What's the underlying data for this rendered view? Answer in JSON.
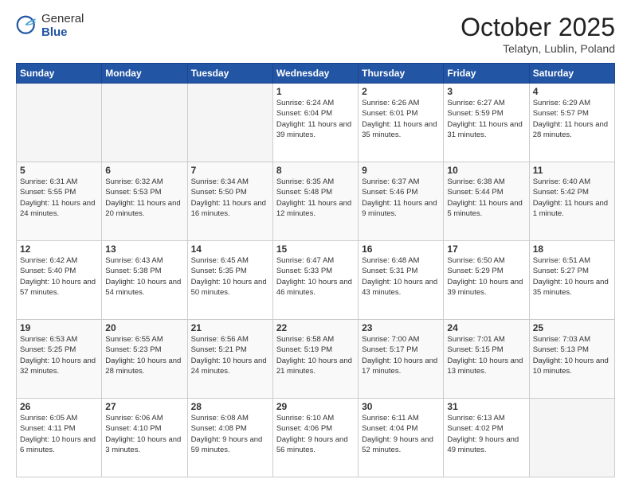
{
  "logo": {
    "general": "General",
    "blue": "Blue"
  },
  "header": {
    "month": "October 2025",
    "location": "Telatyn, Lublin, Poland"
  },
  "weekdays": [
    "Sunday",
    "Monday",
    "Tuesday",
    "Wednesday",
    "Thursday",
    "Friday",
    "Saturday"
  ],
  "weeks": [
    [
      {
        "day": "",
        "sunrise": "",
        "sunset": "",
        "daylight": ""
      },
      {
        "day": "",
        "sunrise": "",
        "sunset": "",
        "daylight": ""
      },
      {
        "day": "",
        "sunrise": "",
        "sunset": "",
        "daylight": ""
      },
      {
        "day": "1",
        "sunrise": "Sunrise: 6:24 AM",
        "sunset": "Sunset: 6:04 PM",
        "daylight": "Daylight: 11 hours and 39 minutes."
      },
      {
        "day": "2",
        "sunrise": "Sunrise: 6:26 AM",
        "sunset": "Sunset: 6:01 PM",
        "daylight": "Daylight: 11 hours and 35 minutes."
      },
      {
        "day": "3",
        "sunrise": "Sunrise: 6:27 AM",
        "sunset": "Sunset: 5:59 PM",
        "daylight": "Daylight: 11 hours and 31 minutes."
      },
      {
        "day": "4",
        "sunrise": "Sunrise: 6:29 AM",
        "sunset": "Sunset: 5:57 PM",
        "daylight": "Daylight: 11 hours and 28 minutes."
      }
    ],
    [
      {
        "day": "5",
        "sunrise": "Sunrise: 6:31 AM",
        "sunset": "Sunset: 5:55 PM",
        "daylight": "Daylight: 11 hours and 24 minutes."
      },
      {
        "day": "6",
        "sunrise": "Sunrise: 6:32 AM",
        "sunset": "Sunset: 5:53 PM",
        "daylight": "Daylight: 11 hours and 20 minutes."
      },
      {
        "day": "7",
        "sunrise": "Sunrise: 6:34 AM",
        "sunset": "Sunset: 5:50 PM",
        "daylight": "Daylight: 11 hours and 16 minutes."
      },
      {
        "day": "8",
        "sunrise": "Sunrise: 6:35 AM",
        "sunset": "Sunset: 5:48 PM",
        "daylight": "Daylight: 11 hours and 12 minutes."
      },
      {
        "day": "9",
        "sunrise": "Sunrise: 6:37 AM",
        "sunset": "Sunset: 5:46 PM",
        "daylight": "Daylight: 11 hours and 9 minutes."
      },
      {
        "day": "10",
        "sunrise": "Sunrise: 6:38 AM",
        "sunset": "Sunset: 5:44 PM",
        "daylight": "Daylight: 11 hours and 5 minutes."
      },
      {
        "day": "11",
        "sunrise": "Sunrise: 6:40 AM",
        "sunset": "Sunset: 5:42 PM",
        "daylight": "Daylight: 11 hours and 1 minute."
      }
    ],
    [
      {
        "day": "12",
        "sunrise": "Sunrise: 6:42 AM",
        "sunset": "Sunset: 5:40 PM",
        "daylight": "Daylight: 10 hours and 57 minutes."
      },
      {
        "day": "13",
        "sunrise": "Sunrise: 6:43 AM",
        "sunset": "Sunset: 5:38 PM",
        "daylight": "Daylight: 10 hours and 54 minutes."
      },
      {
        "day": "14",
        "sunrise": "Sunrise: 6:45 AM",
        "sunset": "Sunset: 5:35 PM",
        "daylight": "Daylight: 10 hours and 50 minutes."
      },
      {
        "day": "15",
        "sunrise": "Sunrise: 6:47 AM",
        "sunset": "Sunset: 5:33 PM",
        "daylight": "Daylight: 10 hours and 46 minutes."
      },
      {
        "day": "16",
        "sunrise": "Sunrise: 6:48 AM",
        "sunset": "Sunset: 5:31 PM",
        "daylight": "Daylight: 10 hours and 43 minutes."
      },
      {
        "day": "17",
        "sunrise": "Sunrise: 6:50 AM",
        "sunset": "Sunset: 5:29 PM",
        "daylight": "Daylight: 10 hours and 39 minutes."
      },
      {
        "day": "18",
        "sunrise": "Sunrise: 6:51 AM",
        "sunset": "Sunset: 5:27 PM",
        "daylight": "Daylight: 10 hours and 35 minutes."
      }
    ],
    [
      {
        "day": "19",
        "sunrise": "Sunrise: 6:53 AM",
        "sunset": "Sunset: 5:25 PM",
        "daylight": "Daylight: 10 hours and 32 minutes."
      },
      {
        "day": "20",
        "sunrise": "Sunrise: 6:55 AM",
        "sunset": "Sunset: 5:23 PM",
        "daylight": "Daylight: 10 hours and 28 minutes."
      },
      {
        "day": "21",
        "sunrise": "Sunrise: 6:56 AM",
        "sunset": "Sunset: 5:21 PM",
        "daylight": "Daylight: 10 hours and 24 minutes."
      },
      {
        "day": "22",
        "sunrise": "Sunrise: 6:58 AM",
        "sunset": "Sunset: 5:19 PM",
        "daylight": "Daylight: 10 hours and 21 minutes."
      },
      {
        "day": "23",
        "sunrise": "Sunrise: 7:00 AM",
        "sunset": "Sunset: 5:17 PM",
        "daylight": "Daylight: 10 hours and 17 minutes."
      },
      {
        "day": "24",
        "sunrise": "Sunrise: 7:01 AM",
        "sunset": "Sunset: 5:15 PM",
        "daylight": "Daylight: 10 hours and 13 minutes."
      },
      {
        "day": "25",
        "sunrise": "Sunrise: 7:03 AM",
        "sunset": "Sunset: 5:13 PM",
        "daylight": "Daylight: 10 hours and 10 minutes."
      }
    ],
    [
      {
        "day": "26",
        "sunrise": "Sunrise: 6:05 AM",
        "sunset": "Sunset: 4:11 PM",
        "daylight": "Daylight: 10 hours and 6 minutes."
      },
      {
        "day": "27",
        "sunrise": "Sunrise: 6:06 AM",
        "sunset": "Sunset: 4:10 PM",
        "daylight": "Daylight: 10 hours and 3 minutes."
      },
      {
        "day": "28",
        "sunrise": "Sunrise: 6:08 AM",
        "sunset": "Sunset: 4:08 PM",
        "daylight": "Daylight: 9 hours and 59 minutes."
      },
      {
        "day": "29",
        "sunrise": "Sunrise: 6:10 AM",
        "sunset": "Sunset: 4:06 PM",
        "daylight": "Daylight: 9 hours and 56 minutes."
      },
      {
        "day": "30",
        "sunrise": "Sunrise: 6:11 AM",
        "sunset": "Sunset: 4:04 PM",
        "daylight": "Daylight: 9 hours and 52 minutes."
      },
      {
        "day": "31",
        "sunrise": "Sunrise: 6:13 AM",
        "sunset": "Sunset: 4:02 PM",
        "daylight": "Daylight: 9 hours and 49 minutes."
      },
      {
        "day": "",
        "sunrise": "",
        "sunset": "",
        "daylight": ""
      }
    ]
  ]
}
